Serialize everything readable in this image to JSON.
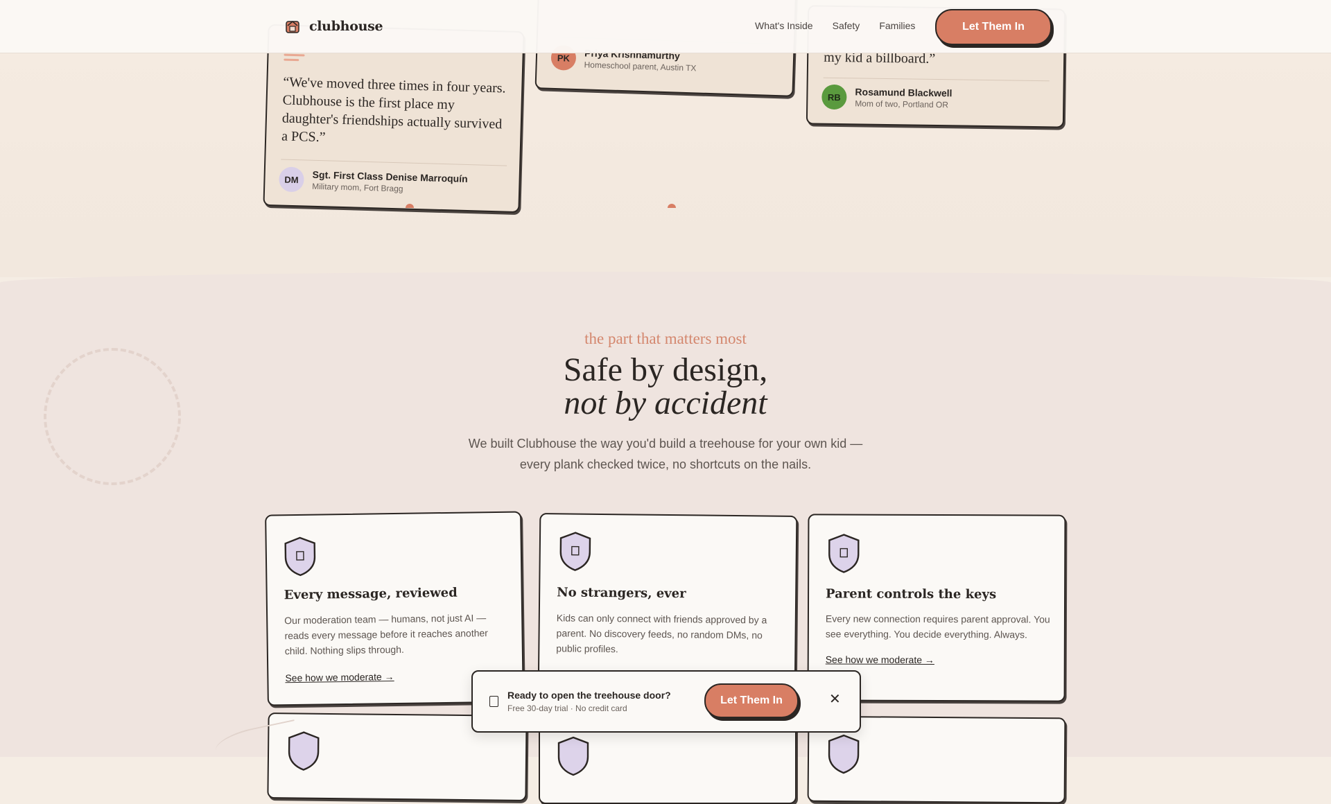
{
  "nav": {
    "logo_text": "clubhouse",
    "links": [
      "What's Inside",
      "Safety",
      "Families"
    ],
    "cta": "Let Them In"
  },
  "testimonials": [
    {
      "quote": "“We've moved three times in four years. Clubhouse is the first place my daughter's friendships actually survived a PCS.”",
      "initials": "DM",
      "name": "Sgt. First Class Denise Marroquín",
      "role": "Military mom, Fort Bragg",
      "avatar_color": "#d9cfe8"
    },
    {
      "initials": "PK",
      "name": "Priya Krishnamurthy",
      "role": "Homeschool parent, Austin TX",
      "avatar_color": "#d87e64"
    },
    {
      "quote_tail": "my kid a billboard.”",
      "initials": "RB",
      "name": "Rosamund Blackwell",
      "role": "Mom of two, Portland OR",
      "avatar_color": "#5a9a3e"
    }
  ],
  "safety": {
    "eyebrow": "the part that matters most",
    "title_line1": "Safe by design,",
    "title_line2": "not by accident",
    "intro": "We built Clubhouse the way you'd build a treehouse for your own kid — every plank checked twice, no shortcuts on the nails.",
    "features": [
      {
        "title": "Every message, reviewed",
        "desc": "Our moderation team — humans, not just AI — reads every message before it reaches another child. Nothing slips through.",
        "link": "See how we moderate →"
      },
      {
        "title": "No strangers, ever",
        "desc": "Kids can only connect with friends approved by a parent. No discovery feeds, no random DMs, no public profiles."
      },
      {
        "title": "Parent controls the keys",
        "desc": "Every new connection requires parent approval. You see everything. You decide everything. Always.",
        "link": "See how we moderate →"
      }
    ]
  },
  "sticky_bar": {
    "title": "Ready to open the treehouse door?",
    "subtitle": "Free 30-day trial · No credit card",
    "cta": "Let Them In",
    "close": "✕"
  },
  "colors": {
    "accent": "#d87e64",
    "ink": "#2b2623",
    "shield_fill": "#ddd3ea"
  }
}
